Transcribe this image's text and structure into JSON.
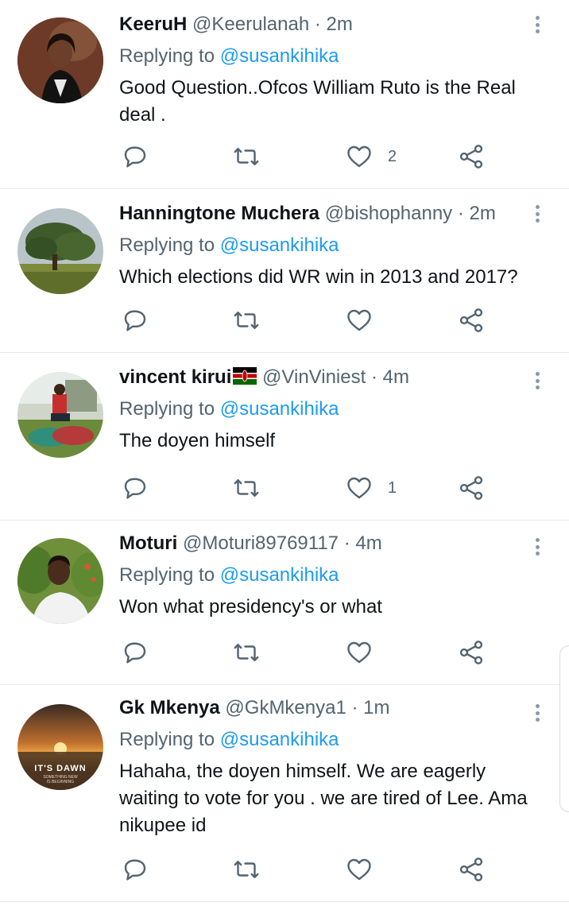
{
  "common": {
    "replying_to_label": "Replying to",
    "mention": "@susankihika"
  },
  "tweets": [
    {
      "name": "KeeruH",
      "handle": "@Keerulanah",
      "dot": "·",
      "time": "2m",
      "text_lines": [
        "Good Question..Ofcos William Ruto is the Real",
        "deal ."
      ],
      "likes": "2",
      "retweets": "",
      "replies": ""
    },
    {
      "name": "Hanningtone Muchera",
      "handle": "@bishophanny",
      "dot": "·",
      "time": "2m",
      "text_lines": [
        "Which elections did WR win in 2013 and 2017?"
      ],
      "likes": "",
      "retweets": "",
      "replies": ""
    },
    {
      "name": "vincent kirui",
      "handle": "@VinViniest",
      "dot": "·",
      "time": "4m",
      "flag": "kenya-flag-icon",
      "text_lines": [
        "The doyen himself"
      ],
      "likes": "1",
      "retweets": "",
      "replies": ""
    },
    {
      "name": "Moturi",
      "handle": "@Moturi89769117",
      "dot": "·",
      "time": "4m",
      "text_lines": [
        "Won what presidency's or what"
      ],
      "likes": "",
      "retweets": "",
      "replies": ""
    },
    {
      "name": "Gk Mkenya",
      "handle": "@GkMkenya1",
      "dot": "·",
      "time": "1m",
      "text_lines": [
        "Hahaha, the doyen himself. We are eagerly",
        "waiting to vote for you . we are tired of Lee. Ama",
        "nikupee id"
      ],
      "likes": "",
      "retweets": "",
      "replies": "",
      "avatar_text": "IT'S DAWN",
      "avatar_subtext": "SOMETHING NEW\nIS BEGINNING"
    }
  ],
  "icons": {
    "reply": "speech-bubble-icon",
    "retweet": "retweet-icon",
    "like": "heart-icon",
    "share": "share-icon",
    "more": "more-vertical-icon"
  },
  "colors": {
    "accent": "#1d9bf0",
    "secondary_text": "#536471",
    "primary_text": "#0f1419",
    "divider": "#e6e9eb"
  }
}
